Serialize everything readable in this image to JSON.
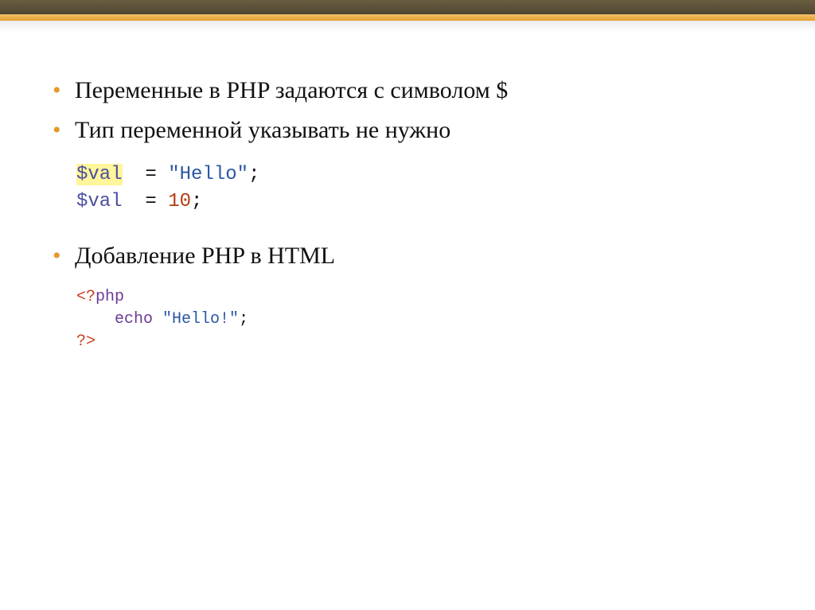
{
  "bullets": {
    "b1": "Переменные в PHP задаются с символом $",
    "b2": "Тип переменной указывать не нужно",
    "b3": "Добавление PHP в HTML"
  },
  "code1": {
    "var1": "$val",
    "eq": "=",
    "str1": "\"Hello\"",
    "semi": ";",
    "var2": "$val",
    "num1": "10"
  },
  "code2": {
    "open": "<?",
    "php": "php",
    "echo": "echo",
    "str": "\"Hello!\"",
    "semi": ";",
    "close": "?>"
  }
}
